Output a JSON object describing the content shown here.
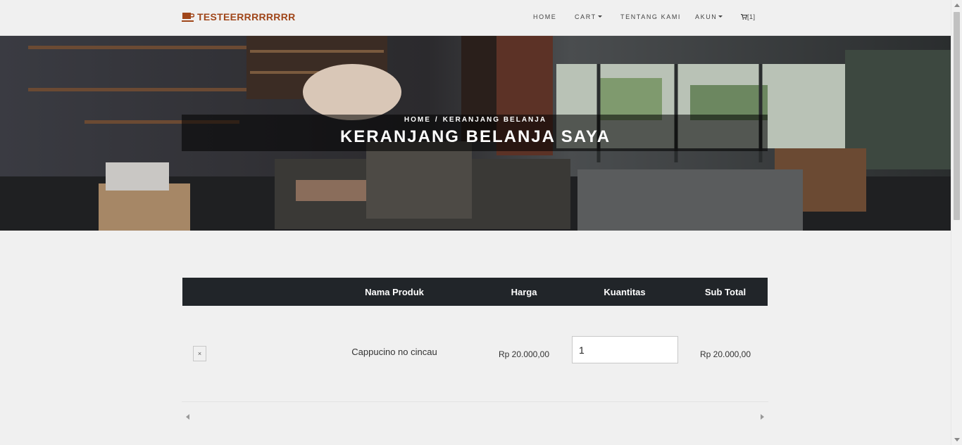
{
  "brand": {
    "name": "TESTEERRRRRRRR",
    "icon": "coffee-cup-icon",
    "color": "#a0461a"
  },
  "nav": {
    "home": "HOME",
    "cart": "CART",
    "about": "TENTANG KAMI",
    "account": "AKUN",
    "cart_count": "[1]"
  },
  "hero": {
    "breadcrumb_home": "HOME",
    "breadcrumb_sep": "/",
    "breadcrumb_current": "KERANJANG BELANJA",
    "title": "KERANJANG BELANJA SAYA"
  },
  "cart_table": {
    "headers": {
      "product": "Nama Produk",
      "price": "Harga",
      "qty": "Kuantitas",
      "subtotal": "Sub Total"
    },
    "rows": [
      {
        "remove": "×",
        "product": "Cappucino no cincau",
        "price": "Rp 20.000,00",
        "qty": "1",
        "subtotal": "Rp 20.000,00"
      }
    ]
  }
}
